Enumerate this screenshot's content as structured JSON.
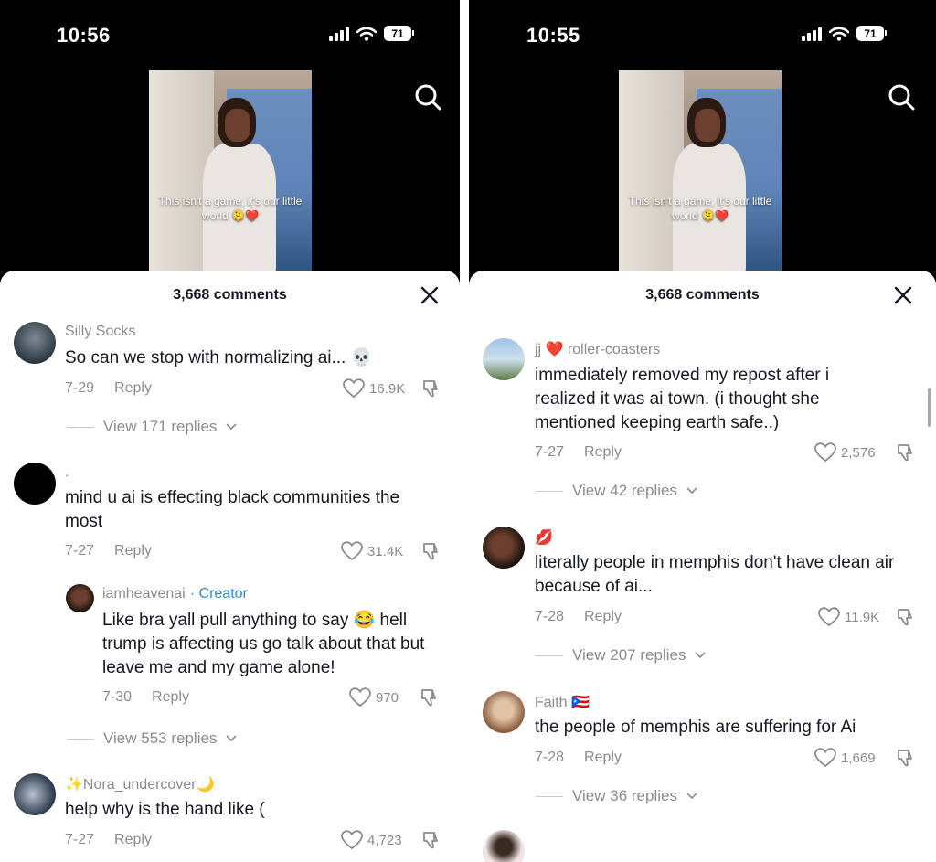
{
  "left": {
    "status_time": "10:56",
    "battery": "71",
    "video_caption": "This isn't a game, it's our little world 🫠❤️",
    "comments_count": "3,668 comments",
    "comments": [
      {
        "name": "Silly Socks",
        "text": "So can we stop with normalizing ai... 💀",
        "date": "7-29",
        "reply": "Reply",
        "likes": "16.9K",
        "view_replies": "View 171 replies"
      },
      {
        "name": ".",
        "text": "mind u ai is effecting black communities the most",
        "date": "7-27",
        "reply": "Reply",
        "likes": "31.4K"
      },
      {
        "name": "iamheavenai",
        "creator": "· Creator",
        "text": "Like bra yall pull anything to say 😂 hell trump is affecting us go talk about that but leave me and my game alone!",
        "date": "7-30",
        "reply": "Reply",
        "likes": "970",
        "view_replies": "View 553 replies"
      },
      {
        "name": "✨Nora_undercover🌙",
        "text": "help why is the hand like (",
        "date": "7-27",
        "reply": "Reply",
        "likes": "4,723"
      }
    ]
  },
  "right": {
    "status_time": "10:55",
    "battery": "71",
    "video_caption": "This isn't a game, it's our little world 🫠❤️",
    "comments_count": "3,668 comments",
    "comments": [
      {
        "name": "jj ❤️ roller-coasters",
        "text": "immediately removed my repost after i realized it was ai town. (i thought she mentioned keeping earth safe..)",
        "date": "7-27",
        "reply": "Reply",
        "likes": "2,576",
        "view_replies": "View 42 replies"
      },
      {
        "name": "💋",
        "text": "literally people in memphis don't have clean air because of ai...",
        "date": "7-28",
        "reply": "Reply",
        "likes": "11.9K",
        "view_replies": "View 207 replies"
      },
      {
        "name": "Faith 🇵🇷",
        "text": "the people of memphis are suffering for Ai",
        "date": "7-28",
        "reply": "Reply",
        "likes": "1,669",
        "view_replies": "View 36 replies"
      }
    ]
  },
  "icons": {
    "search": "search-icon",
    "close": "close-icon",
    "like": "heart-icon",
    "dislike": "thumbs-down-icon",
    "expand": "chevron-down-icon"
  },
  "colors": {
    "creator": "#2a8bdb",
    "meta_text": "#8a8b91",
    "primary_text": "#161823"
  }
}
